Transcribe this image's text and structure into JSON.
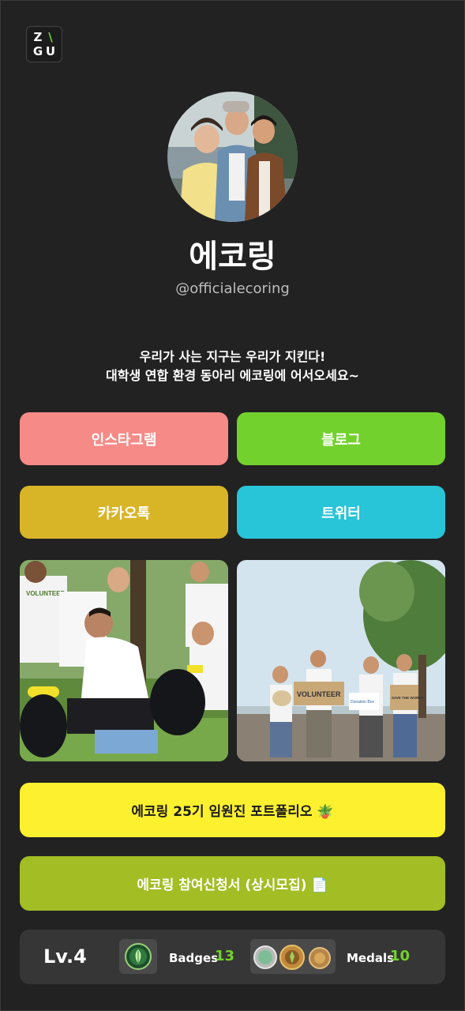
{
  "logo": {
    "l1": "Z",
    "l2": "\\",
    "l3": "G",
    "l4": "U"
  },
  "profile": {
    "name": "에코링",
    "handle": "@officialecoring",
    "intro_line1": "우리가 사는 지구는 우리가 지킨다!",
    "intro_line2": "대학생 연합 환경 동아리 에코링에 어서오세요~"
  },
  "links": {
    "instagram": "인스타그램",
    "blog": "블로그",
    "kakao": "카카오톡",
    "twitter": "트위터",
    "portfolio": "에코링 25기 임원진 포트폴리오 🪴",
    "application": "에코링 참여신청서 (상시모집) 📄"
  },
  "photos": {
    "left_shirt_text": "VOLUNTEER",
    "right_sign_1": "VOLUNTEER",
    "right_sign_2": "SAVE THE WORLD",
    "right_sign_3": "Donation Box"
  },
  "stats": {
    "level": "Lv.4",
    "badges_label": "Badges",
    "badges_count": "13",
    "medals_label": "Medals",
    "medals_count": "10"
  },
  "colors": {
    "background": "#222222",
    "instagram": "#f68a86",
    "blog": "#73d12e",
    "kakao": "#d8b427",
    "twitter": "#28c4d7",
    "portfolio": "#fdf12f",
    "application": "#a3bd24",
    "accent_count": "#73d12e"
  }
}
